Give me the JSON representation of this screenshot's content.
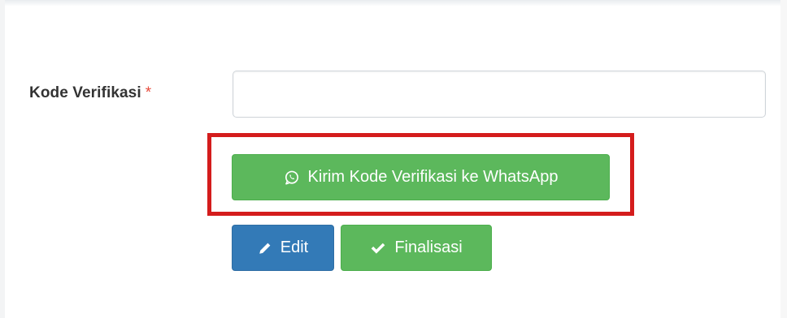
{
  "form": {
    "field_label": "Kode Verifikasi",
    "required_marker": "*",
    "input_value": "",
    "input_placeholder": ""
  },
  "buttons": {
    "whatsapp": {
      "label": "Kirim Kode Verifikasi ke WhatsApp",
      "icon": "whatsapp-icon",
      "color": "#5cb85c"
    },
    "edit": {
      "label": "Edit",
      "icon": "pencil-icon",
      "color": "#337ab7"
    },
    "finalize": {
      "label": "Finalisasi",
      "icon": "check-icon",
      "color": "#5cb85c"
    }
  },
  "highlight": {
    "color": "#d41c1c"
  }
}
